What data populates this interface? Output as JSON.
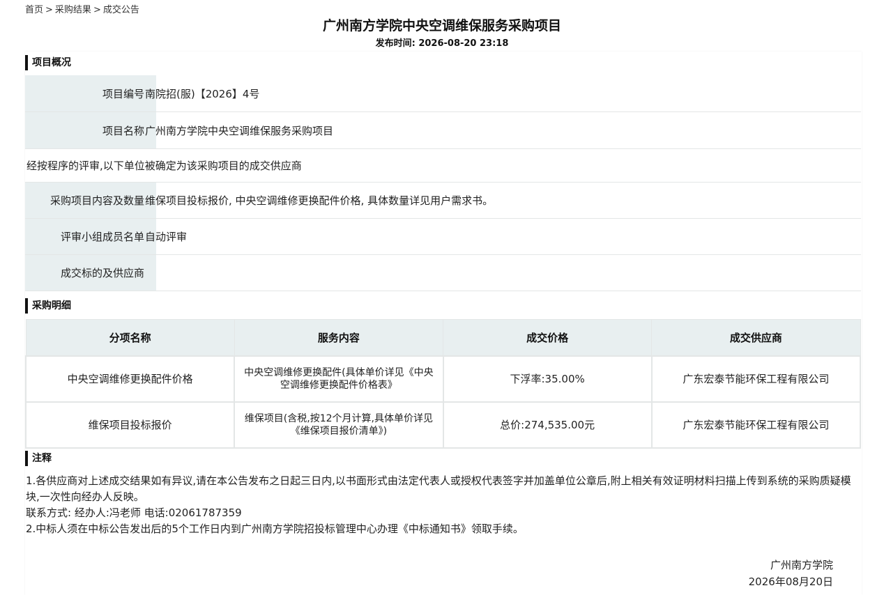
{
  "breadcrumb": {
    "home": "首页",
    "results": "采购结果",
    "current": "成交公告",
    "separator": ">"
  },
  "header": {
    "title": "广州南方学院中央空调维保服务采购项目",
    "publish_label": "发布时间:",
    "publish_time": "2026-08-20 23:18"
  },
  "overview": {
    "heading": "项目概况",
    "project_no_label": "项目编号",
    "project_no": "南院招(服)【2026】4号",
    "project_name_label": "项目名称",
    "project_name": "广州南方学院中央空调维保服务采购项目",
    "statement": "经按程序的评审,以下单位被确定为该采购项目的成交供应商",
    "content_label": "采购项目内容及数量",
    "content": "维保项目投标报价, 中央空调维修更换配件价格, 具体数量详见用户需求书。",
    "committee_label": "评审小组成员名单",
    "committee": "自动评审",
    "winner_label": "成交标的及供应商",
    "winner": ""
  },
  "detail": {
    "heading": "采购明细",
    "columns": [
      "分项名称",
      "服务内容",
      "成交价格",
      "成交供应商"
    ],
    "rows": [
      {
        "item": "中央空调维修更换配件价格",
        "service": "中央空调维修更换配件(具体单价详见《中央空调维修更换配件价格表》",
        "price": "下浮率:35.00%",
        "supplier": "广东宏泰节能环保工程有限公司"
      },
      {
        "item": "维保项目投标报价",
        "service": "维保项目(含税,按12个月计算,具体单价详见《维保项目报价清单》)",
        "price": "总价:274,535.00元",
        "supplier": "广东宏泰节能环保工程有限公司"
      }
    ]
  },
  "notes": {
    "heading": "注释",
    "line1": "1.各供应商对上述成交结果如有异议,请在本公告发布之日起三日内,以书面形式由法定代表人或授权代表签字并加盖单位公章后,附上相关有效证明材料扫描上传到系统的采购质疑模块,一次性向经办人反映。",
    "contact": "联系方式: 经办人:冯老师 电话:02061787359",
    "line2": "2.中标人须在中标公告发出后的5个工作日内到广州南方学院招投标管理中心办理《中标通知书》领取手续。"
  },
  "signature": {
    "org": "广州南方学院",
    "date": "2026年08月20日"
  }
}
